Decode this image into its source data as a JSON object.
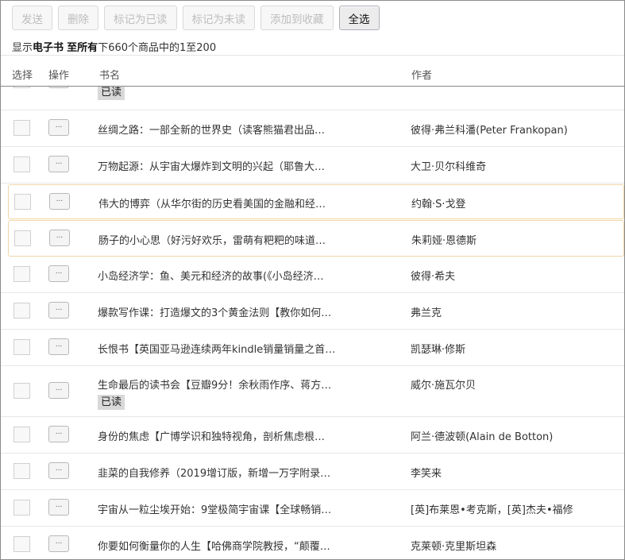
{
  "toolbar": {
    "send": "发送",
    "delete": "删除",
    "mark_read": "标记为已读",
    "mark_unread": "标记为未读",
    "add_collection": "添加到收藏",
    "select_all": "全选"
  },
  "summary": {
    "prefix": "显示",
    "type": "电子书",
    "space": " ",
    "scope": "至所有",
    "rest": "下660个商品中的1至200"
  },
  "columns": {
    "select": "选择",
    "ops": "操作",
    "title": "书名",
    "author": "作者"
  },
  "ops_label": "...",
  "read_badge": "已读",
  "rows": [
    {
      "title": "",
      "author": "",
      "badge": "已读"
    },
    {
      "title": "丝绸之路：一部全新的世界史（读客熊猫君出品…",
      "author": "彼得·弗兰科潘(Peter Frankopan)"
    },
    {
      "title": "万物起源：从宇宙大爆炸到文明的兴起（耶鲁大…",
      "author": "大卫·贝尔科维奇"
    },
    {
      "title": "伟大的博弈（从华尔街的历史看美国的金融和经…",
      "author": "约翰·S·戈登"
    },
    {
      "title": "肠子的小心思（好污好欢乐，雷萌有粑粑的味道…",
      "author": "朱莉娅·恩德斯"
    },
    {
      "title": "小岛经济学：鱼、美元和经济的故事(《小岛经济…",
      "author": "彼得·希夫"
    },
    {
      "title": "爆款写作课：打造爆文的3个黄金法则【教你如何…",
      "author": "弗兰克"
    },
    {
      "title": "长恨书【英国亚马逊连续两年kindle销量销量之首…",
      "author": "凯瑟琳·修斯"
    },
    {
      "title": "生命最后的读书会【豆瓣9分！余秋雨作序、蒋方…",
      "author": "威尔·施瓦尔贝",
      "badge": "已读"
    },
    {
      "title": "身份的焦虑【广博学识和独特视角，剖析焦虑根…",
      "author": "阿兰·德波顿(Alain de Botton)"
    },
    {
      "title": "韭菜的自我修养（2019增订版，新增一万字附录…",
      "author": "李笑来"
    },
    {
      "title": "宇宙从一粒尘埃开始：9堂极简宇宙课【全球畅销…",
      "author": "[英]布莱恩•考克斯，[英]杰夫•福修"
    },
    {
      "title": "你要如何衡量你的人生【哈佛商学院教授，“颠覆…",
      "author": "克莱顿·克里斯坦森"
    }
  ]
}
